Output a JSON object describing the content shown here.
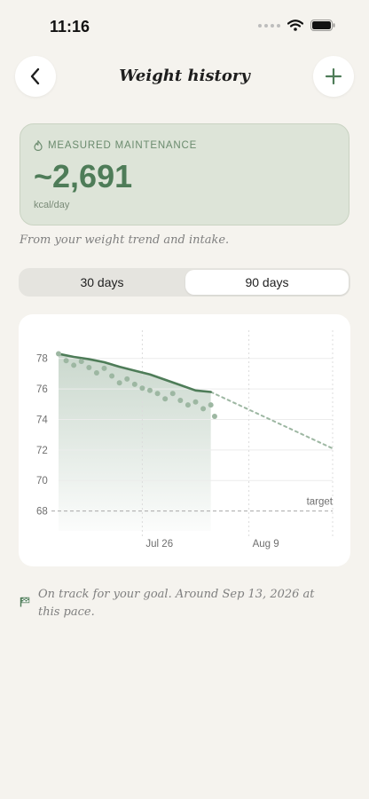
{
  "status": {
    "time": "11:16"
  },
  "header": {
    "title": "Weight history",
    "back_icon": "chevron-left-icon",
    "add_icon": "plus-icon"
  },
  "maintenance": {
    "label": "MEASURED MAINTENANCE",
    "value": "~2,691",
    "unit": "kcal/day",
    "accent": "#4e7c58"
  },
  "trend_note": "From your weight trend and intake.",
  "range": {
    "options": [
      "30 days",
      "90 days"
    ],
    "selected": "90 days"
  },
  "chart_data": {
    "type": "line",
    "yticks": [
      78,
      76,
      74,
      72,
      70,
      68
    ],
    "ylim": [
      66.5,
      79.5
    ],
    "x_range": [
      0,
      36
    ],
    "xticks": [
      {
        "x": 11,
        "label": "Jul 26"
      },
      {
        "x": 25,
        "label": "Aug 9"
      }
    ],
    "target": {
      "value": 68,
      "label": "target"
    },
    "series": [
      {
        "kind": "trend",
        "color": "#4e7c58",
        "points": [
          [
            0,
            78.3
          ],
          [
            2,
            78.1
          ],
          [
            4,
            77.95
          ],
          [
            6,
            77.75
          ],
          [
            8,
            77.45
          ],
          [
            10,
            77.2
          ],
          [
            12,
            76.95
          ],
          [
            14,
            76.6
          ],
          [
            16,
            76.25
          ],
          [
            18,
            75.9
          ],
          [
            20,
            75.8
          ]
        ]
      },
      {
        "kind": "scale-weights",
        "color": "#9db7a2",
        "points": [
          [
            0,
            78.3
          ],
          [
            1,
            77.85
          ],
          [
            2,
            77.55
          ],
          [
            3,
            77.8
          ],
          [
            4,
            77.4
          ],
          [
            5,
            77.05
          ],
          [
            6,
            77.35
          ],
          [
            7,
            76.85
          ],
          [
            8,
            76.4
          ],
          [
            9,
            76.65
          ],
          [
            10,
            76.3
          ],
          [
            11,
            76.05
          ],
          [
            12,
            75.9
          ],
          [
            13,
            75.7
          ],
          [
            14,
            75.35
          ],
          [
            15,
            75.7
          ],
          [
            16,
            75.25
          ],
          [
            17,
            74.95
          ],
          [
            18,
            75.15
          ],
          [
            19,
            74.7
          ],
          [
            20,
            74.95
          ],
          [
            20.5,
            74.2
          ]
        ]
      },
      {
        "kind": "projection",
        "color": "#9db7a2",
        "points": [
          [
            20,
            75.8
          ],
          [
            36,
            72.1
          ]
        ]
      }
    ]
  },
  "goal_note": "On track for your goal. Around Sep 13, 2026 at this pace."
}
